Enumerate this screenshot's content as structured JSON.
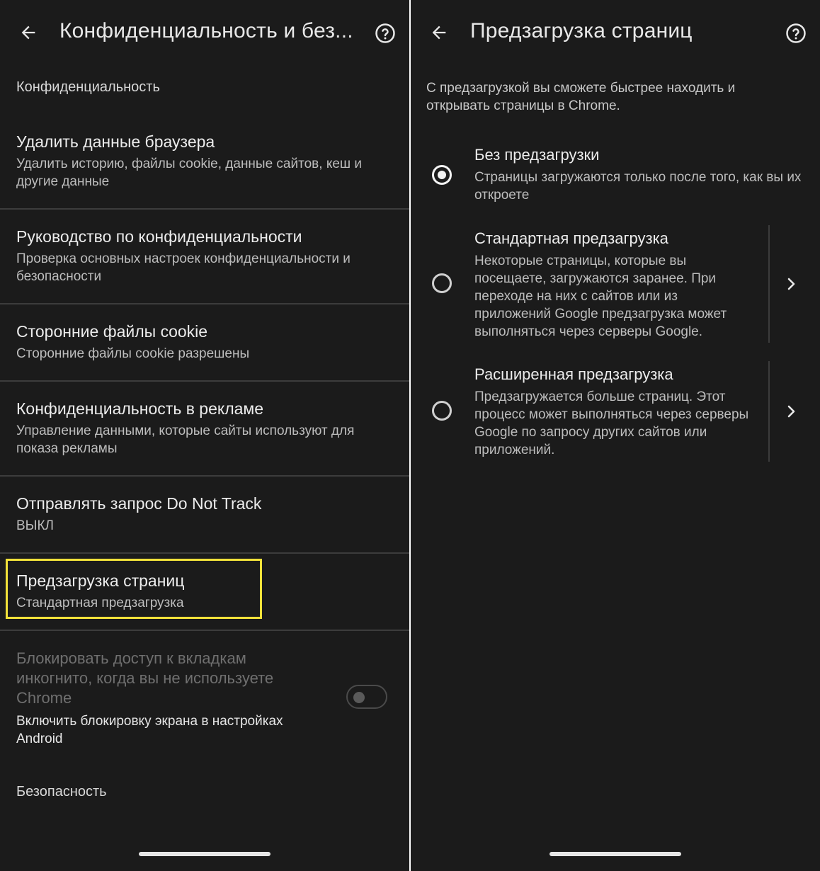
{
  "left": {
    "title": "Конфиденциальность и без...",
    "privacy_header": "Конфиденциальность",
    "items": [
      {
        "title": "Удалить данные браузера",
        "summary": "Удалить историю, файлы cookie, данные сайтов, кеш и другие данные"
      },
      {
        "title": "Руководство по конфиденциальности",
        "summary": "Проверка основных настроек конфиденциальности и безопасности"
      },
      {
        "title": "Сторонние файлы cookie",
        "summary": "Сторонние файлы cookie разрешены"
      },
      {
        "title": "Конфиденциальность в рекламе",
        "summary": "Управление данными, которые сайты используют для показа рекламы"
      },
      {
        "title": "Отправлять запрос Do Not Track",
        "summary": "ВЫКЛ"
      },
      {
        "title": "Предзагрузка страниц",
        "summary": "Стандартная предзагрузка"
      }
    ],
    "incognito_lock": {
      "title": "Блокировать доступ к вкладкам инкогнито, когда вы не используете Chrome",
      "summary": "Включить блокировку экрана в настройках Android",
      "enabled": false
    },
    "security_header": "Безопасность",
    "highlight_color": "#f2e23a"
  },
  "right": {
    "title": "Предзагрузка страниц",
    "intro": "С предзагрузкой вы сможете быстрее находить и открывать страницы в Chrome.",
    "options": [
      {
        "title": "Без предзагрузки",
        "description": "Страницы загружаются только после того, как вы их откроете",
        "selected": true
      },
      {
        "title": "Стандартная предзагрузка",
        "description": "Некоторые страницы, которые вы посещаете, загружаются заранее. При переходе на них с сайтов или из приложений Google предзагрузка может выполняться через серверы Google.",
        "selected": false
      },
      {
        "title": "Расширенная предзагрузка",
        "description": "Предзагружается больше страниц. Этот процесс может выполняться через серверы Google по запросу других сайтов или приложений.",
        "selected": false
      }
    ]
  },
  "icons": [
    "back-arrow-icon",
    "help-circle-icon",
    "chevron-right-icon",
    "radio-icon"
  ],
  "colors": {
    "background": "#1b1b1b",
    "divider": "#3c3c3c",
    "text": "#ececec",
    "secondary_text": "#bdbdbd"
  }
}
